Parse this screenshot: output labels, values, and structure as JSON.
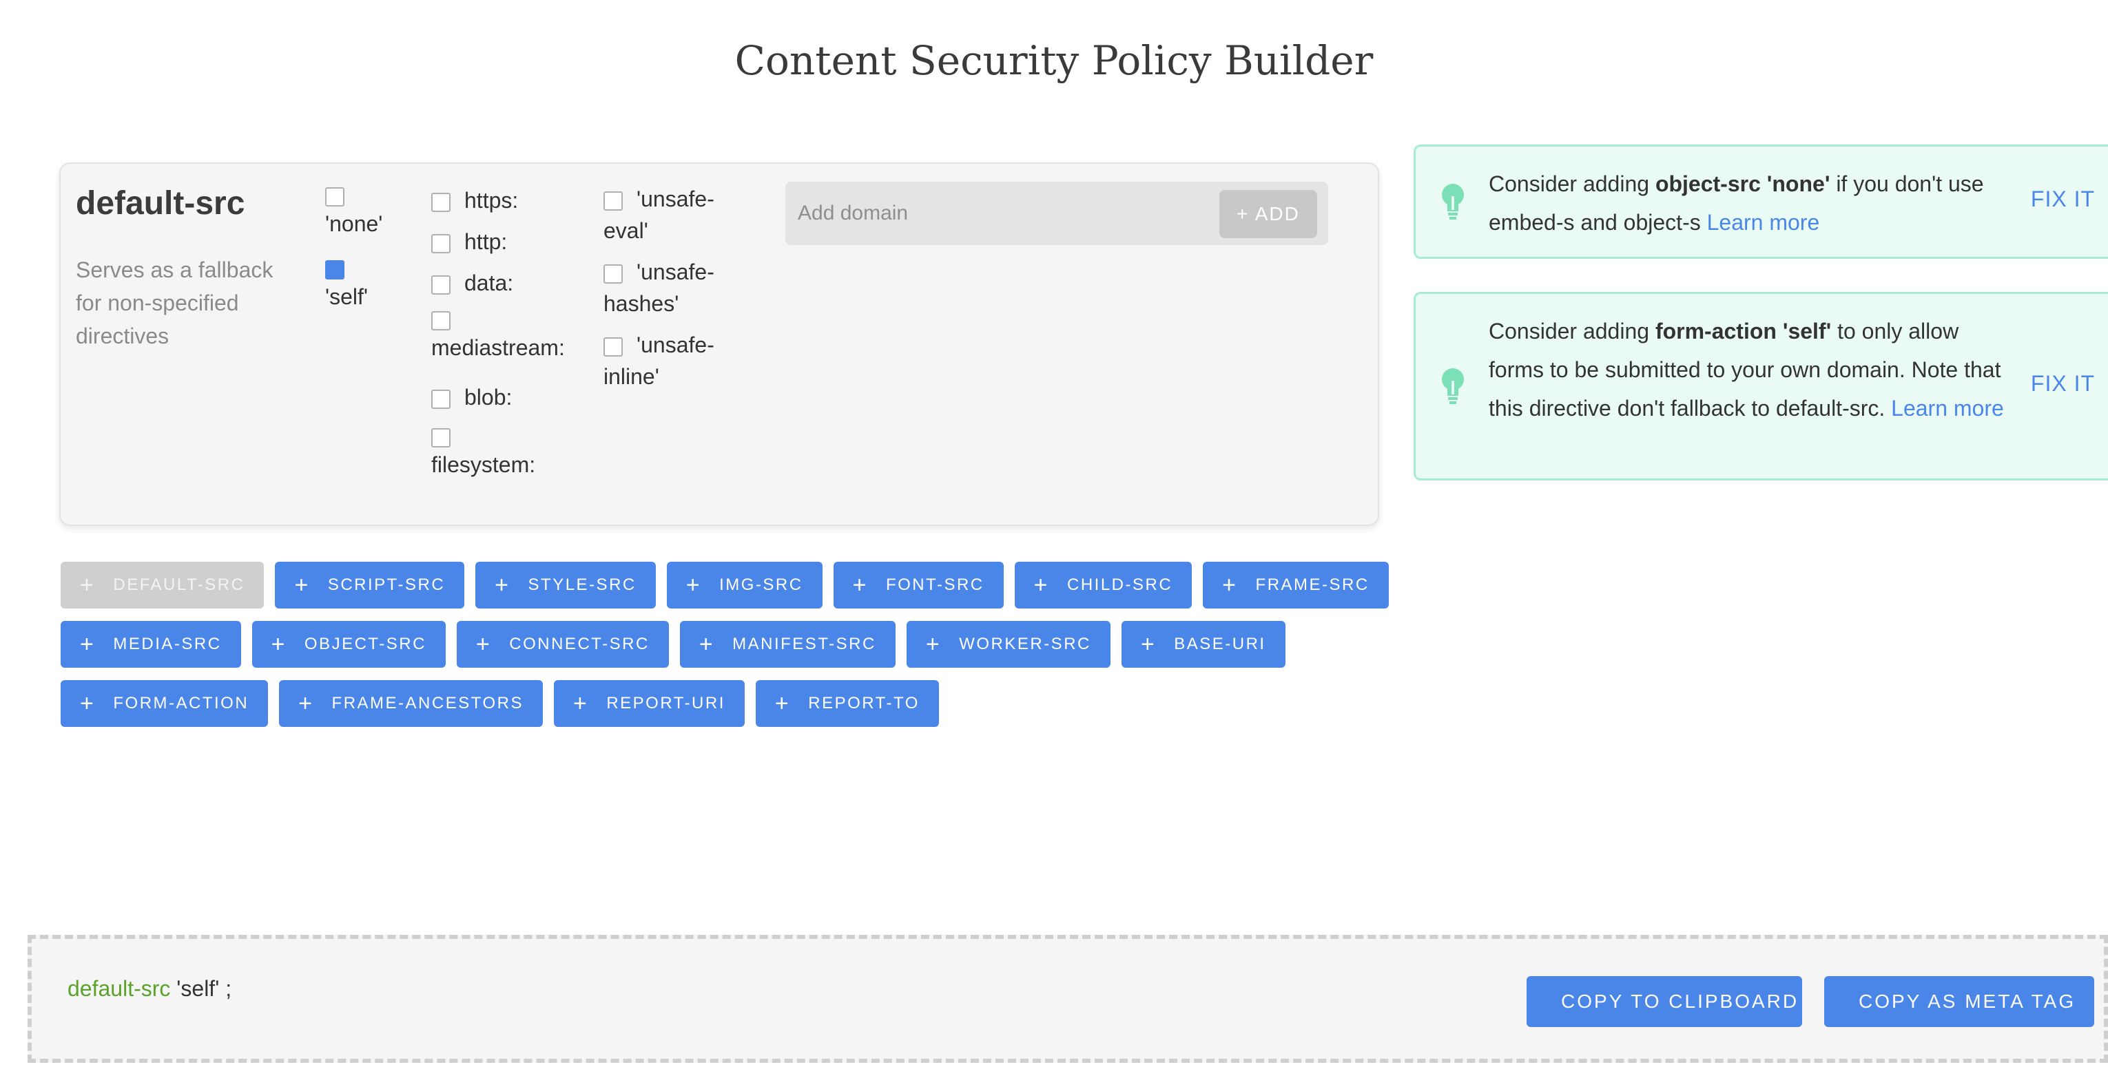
{
  "page": {
    "title": "Content Security Policy Builder"
  },
  "directive": {
    "name": "default-src",
    "description": "Serves as a fallback for non-specified directives",
    "keywords": [
      {
        "label": "'none'",
        "checked": false
      },
      {
        "label": "'self'",
        "checked": true
      }
    ],
    "schemes": [
      {
        "label": "https:",
        "checked": false
      },
      {
        "label": "http:",
        "checked": false
      },
      {
        "label": "data:",
        "checked": false
      },
      {
        "label": "mediastream:",
        "checked": false
      },
      {
        "label": "blob:",
        "checked": false
      },
      {
        "label": "filesystem:",
        "checked": false
      }
    ],
    "unsafe": [
      {
        "label_line1": "'unsafe-",
        "label_line2": "eval'",
        "checked": false
      },
      {
        "label_line1": "'unsafe-",
        "label_line2": "hashes'",
        "checked": false
      },
      {
        "label_line1": "'unsafe-",
        "label_line2": "inline'",
        "checked": false
      }
    ],
    "domain_placeholder": "Add domain",
    "domain_value": "",
    "add_label": "+ ADD"
  },
  "suggestions": [
    {
      "prefix": "Consider adding ",
      "bold": "object-src 'none'",
      "text": " if you don't use embed-s and object-s ",
      "link": "Learn more",
      "fix_label": "FIX IT",
      "icon": "lightbulb-icon"
    },
    {
      "prefix": "Consider adding ",
      "bold": "form-action 'self'",
      "text": " to only allow forms to be submitted to your own domain. Note that this directive don't fallback to default-src. ",
      "link": "Learn more",
      "fix_label": "FIX IT",
      "icon": "lightbulb-icon"
    }
  ],
  "directive_buttons": {
    "row1": [
      {
        "label": "DEFAULT-SRC",
        "disabled": true
      },
      {
        "label": "SCRIPT-SRC",
        "disabled": false
      },
      {
        "label": "STYLE-SRC",
        "disabled": false
      },
      {
        "label": "IMG-SRC",
        "disabled": false
      },
      {
        "label": "FONT-SRC",
        "disabled": false
      },
      {
        "label": "CHILD-SRC",
        "disabled": false
      },
      {
        "label": "FRAME-SRC",
        "disabled": false
      }
    ],
    "row2": [
      {
        "label": "MEDIA-SRC",
        "disabled": false
      },
      {
        "label": "OBJECT-SRC",
        "disabled": false
      },
      {
        "label": "CONNECT-SRC",
        "disabled": false
      },
      {
        "label": "MANIFEST-SRC",
        "disabled": false
      },
      {
        "label": "WORKER-SRC",
        "disabled": false
      },
      {
        "label": "BASE-URI",
        "disabled": false
      }
    ],
    "row3": [
      {
        "label": "FORM-ACTION",
        "disabled": false
      },
      {
        "label": "FRAME-ANCESTORS",
        "disabled": false
      },
      {
        "label": "REPORT-URI",
        "disabled": false
      },
      {
        "label": "REPORT-TO",
        "disabled": false
      }
    ]
  },
  "output": {
    "policy_directive": "default-src",
    "policy_value": " 'self' ;",
    "copy_clipboard_label": "COPY TO CLIPBOARD",
    "copy_meta_label": "COPY AS META TAG"
  },
  "colors": {
    "accent": "#4a86e8",
    "suggest_bg": "#e9fbf4",
    "suggest_border": "#a6ecd0",
    "policy_directive": "#5aa22a",
    "disabled": "#cfcfcf"
  }
}
